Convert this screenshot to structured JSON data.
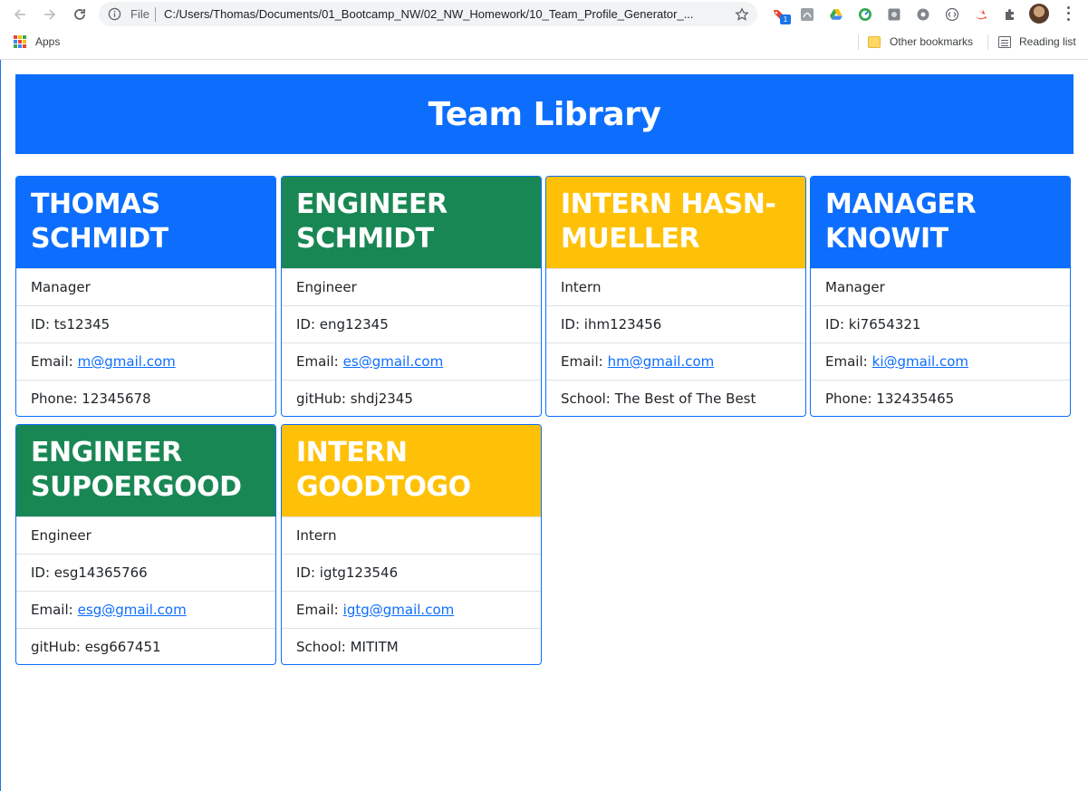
{
  "browser": {
    "file_label": "File",
    "url": "C:/Users/Thomas/Documents/01_Bootcamp_NW/02_NW_Homework/10_Team_Profile_Generator_...",
    "extension_badge": "1",
    "bookmarks": {
      "apps_label": "Apps",
      "other_label": "Other bookmarks",
      "reading_label": "Reading list"
    }
  },
  "page": {
    "title": "Team Library",
    "cards": [
      {
        "name": "THOMAS SCHMIDT",
        "color": "#0d6efd",
        "role": "Manager",
        "id": "ID: ts12345",
        "email_label": "Email:",
        "email": "m@gmail.com",
        "extra": "Phone: 12345678"
      },
      {
        "name": "ENGINEER SCHMIDT",
        "color": "#198754",
        "role": "Engineer",
        "id": "ID: eng12345",
        "email_label": "Email:",
        "email": "es@gmail.com",
        "extra": "gitHub: shdj2345"
      },
      {
        "name": "INTERN HASN-MUELLER",
        "color": "#ffc107",
        "role": "Intern",
        "id": "ID: ihm123456",
        "email_label": "Email:",
        "email": "hm@gmail.com",
        "extra": "School: The Best of The Best"
      },
      {
        "name": "MANAGER KNOWIT",
        "color": "#0d6efd",
        "role": "Manager",
        "id": "ID: ki7654321",
        "email_label": "Email:",
        "email": "ki@gmail.com",
        "extra": "Phone: 132435465"
      },
      {
        "name": "ENGINEER SUPOERGOOD",
        "color": "#198754",
        "role": "Engineer",
        "id": "ID: esg14365766",
        "email_label": "Email:",
        "email": "esg@gmail.com",
        "extra": "gitHub: esg667451"
      },
      {
        "name": "INTERN GOODTOGO",
        "color": "#ffc107",
        "role": "Intern",
        "id": "ID: igtg123546",
        "email_label": "Email:",
        "email": "igtg@gmail.com",
        "extra": "School: MITITM"
      }
    ]
  }
}
